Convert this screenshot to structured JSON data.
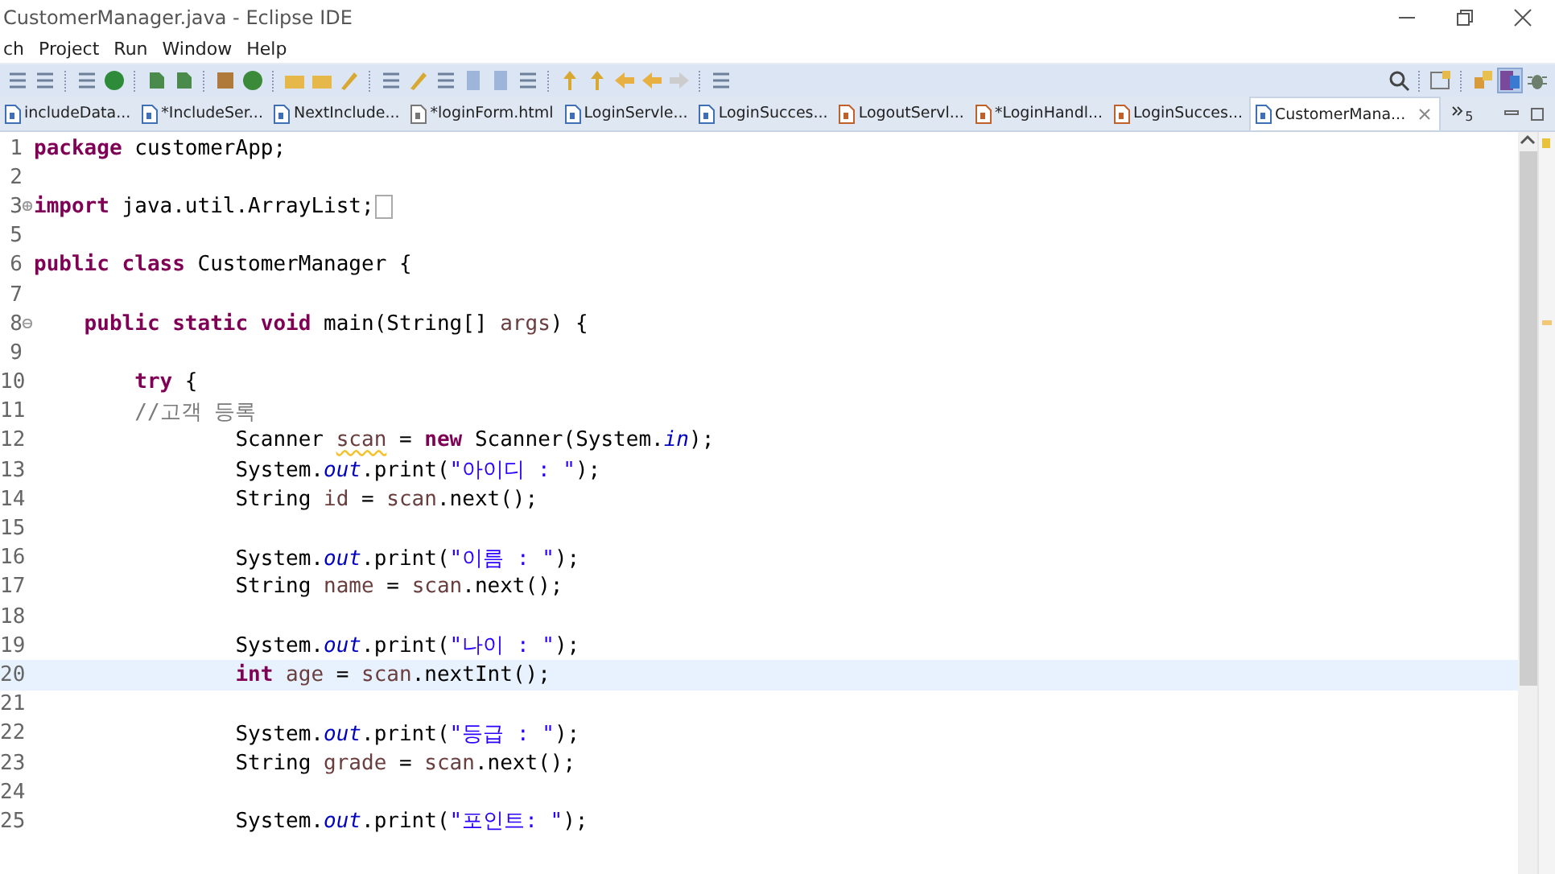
{
  "window": {
    "title": "CustomerManager.java - Eclipse IDE"
  },
  "menu": [
    "ch",
    "Project",
    "Run",
    "Window",
    "Help"
  ],
  "tabs": [
    {
      "label": "includeData...",
      "selected": false,
      "kind": "java"
    },
    {
      "label": "*IncludeSer...",
      "selected": false,
      "kind": "java"
    },
    {
      "label": "NextInclude...",
      "selected": false,
      "kind": "java"
    },
    {
      "label": "*loginForm.html",
      "selected": false,
      "kind": "html"
    },
    {
      "label": "LoginServle...",
      "selected": false,
      "kind": "java"
    },
    {
      "label": "LoginSucces...",
      "selected": false,
      "kind": "java"
    },
    {
      "label": "LogoutServl...",
      "selected": false,
      "kind": "servlet"
    },
    {
      "label": "*LoginHandl...",
      "selected": false,
      "kind": "servlet"
    },
    {
      "label": "LoginSucces...",
      "selected": false,
      "kind": "servlet"
    },
    {
      "label": "CustomerMana...",
      "selected": true,
      "kind": "java"
    }
  ],
  "overflow": {
    "count": "5"
  },
  "editor": {
    "lines": [
      {
        "number": "1",
        "current": false,
        "tokens": [
          {
            "text": "package",
            "kind": "keyword"
          },
          {
            "text": " customerApp;",
            "kind": "plain"
          }
        ]
      },
      {
        "number": "2",
        "current": false
      },
      {
        "number": "3",
        "current": false,
        "folded": true,
        "tokens": [
          {
            "text": "import",
            "kind": "keyword"
          },
          {
            "text": " java.util.ArrayList;",
            "kind": "plain"
          }
        ]
      },
      {
        "number": "5",
        "current": false
      },
      {
        "number": "6",
        "current": false,
        "tokens": [
          {
            "text": "public class",
            "kind": "keyword"
          },
          {
            "text": " CustomerManager {",
            "kind": "plain"
          }
        ]
      },
      {
        "number": "7",
        "current": false
      },
      {
        "number": "8",
        "current": false,
        "folded": false,
        "tokens": [
          {
            "text": "    public static void",
            "kind": "keyword"
          },
          {
            "text": " main(String[] ",
            "kind": "plain"
          },
          {
            "text": "args",
            "kind": "local"
          },
          {
            "text": ") {",
            "kind": "plain"
          }
        ]
      },
      {
        "number": "9",
        "current": false
      },
      {
        "number": "10",
        "current": false,
        "tokens": [
          {
            "text": "        try",
            "kind": "keyword"
          },
          {
            "text": " {",
            "kind": "plain"
          }
        ]
      },
      {
        "number": "11",
        "current": false,
        "tokens": [
          {
            "text": "        //고객 등록",
            "kind": "comment"
          }
        ]
      },
      {
        "number": "12",
        "current": false,
        "tokens": [
          {
            "text": "                Scanner ",
            "kind": "plain"
          },
          {
            "text": "scan",
            "kind": "warning"
          },
          {
            "text": " = ",
            "kind": "plain"
          },
          {
            "text": "new",
            "kind": "keyword"
          },
          {
            "text": " Scanner(System.",
            "kind": "plain"
          },
          {
            "text": "in",
            "kind": "field"
          },
          {
            "text": ");",
            "kind": "plain"
          }
        ]
      },
      {
        "number": "13",
        "current": false,
        "tokens": [
          {
            "text": "                System.",
            "kind": "plain"
          },
          {
            "text": "out",
            "kind": "field"
          },
          {
            "text": ".print(",
            "kind": "plain"
          },
          {
            "text": "\"아이디 : \"",
            "kind": "string"
          },
          {
            "text": ");",
            "kind": "plain"
          }
        ]
      },
      {
        "number": "14",
        "current": false,
        "tokens": [
          {
            "text": "                String ",
            "kind": "plain"
          },
          {
            "text": "id",
            "kind": "local"
          },
          {
            "text": " = ",
            "kind": "plain"
          },
          {
            "text": "scan",
            "kind": "local"
          },
          {
            "text": ".next();",
            "kind": "plain"
          }
        ]
      },
      {
        "number": "15",
        "current": false
      },
      {
        "number": "16",
        "current": false,
        "tokens": [
          {
            "text": "                System.",
            "kind": "plain"
          },
          {
            "text": "out",
            "kind": "field"
          },
          {
            "text": ".print(",
            "kind": "plain"
          },
          {
            "text": "\"이름 : \"",
            "kind": "string"
          },
          {
            "text": ");",
            "kind": "plain"
          }
        ]
      },
      {
        "number": "17",
        "current": false,
        "tokens": [
          {
            "text": "                String ",
            "kind": "plain"
          },
          {
            "text": "name",
            "kind": "local"
          },
          {
            "text": " = ",
            "kind": "plain"
          },
          {
            "text": "scan",
            "kind": "local"
          },
          {
            "text": ".next();",
            "kind": "plain"
          }
        ]
      },
      {
        "number": "18",
        "current": false
      },
      {
        "number": "19",
        "current": false,
        "tokens": [
          {
            "text": "                System.",
            "kind": "plain"
          },
          {
            "text": "out",
            "kind": "field"
          },
          {
            "text": ".print(",
            "kind": "plain"
          },
          {
            "text": "\"나이 : \"",
            "kind": "string"
          },
          {
            "text": ");",
            "kind": "plain"
          }
        ]
      },
      {
        "number": "20",
        "current": true,
        "tokens": [
          {
            "text": "                int",
            "kind": "keyword"
          },
          {
            "text": " age",
            "kind": "local"
          },
          {
            "text": " = ",
            "kind": "plain"
          },
          {
            "text": "scan",
            "kind": "local"
          },
          {
            "text": ".nextInt();",
            "kind": "plain"
          }
        ]
      },
      {
        "number": "21",
        "current": false
      },
      {
        "number": "22",
        "current": false,
        "tokens": [
          {
            "text": "                System.",
            "kind": "plain"
          },
          {
            "text": "out",
            "kind": "field"
          },
          {
            "text": ".print(",
            "kind": "plain"
          },
          {
            "text": "\"등급 : \"",
            "kind": "string"
          },
          {
            "text": ");",
            "kind": "plain"
          }
        ]
      },
      {
        "number": "23",
        "current": false,
        "tokens": [
          {
            "text": "                String ",
            "kind": "plain"
          },
          {
            "text": "grade",
            "kind": "local"
          },
          {
            "text": " = ",
            "kind": "plain"
          },
          {
            "text": "scan",
            "kind": "local"
          },
          {
            "text": ".next();",
            "kind": "plain"
          }
        ]
      },
      {
        "number": "24",
        "current": false
      },
      {
        "number": "25",
        "current": false,
        "tokens": [
          {
            "text": "                System.",
            "kind": "plain"
          },
          {
            "text": "out",
            "kind": "field"
          },
          {
            "text": ".print(",
            "kind": "plain"
          },
          {
            "text": "\"포인트: \"",
            "kind": "string"
          },
          {
            "text": ");",
            "kind": "plain"
          }
        ]
      }
    ]
  }
}
